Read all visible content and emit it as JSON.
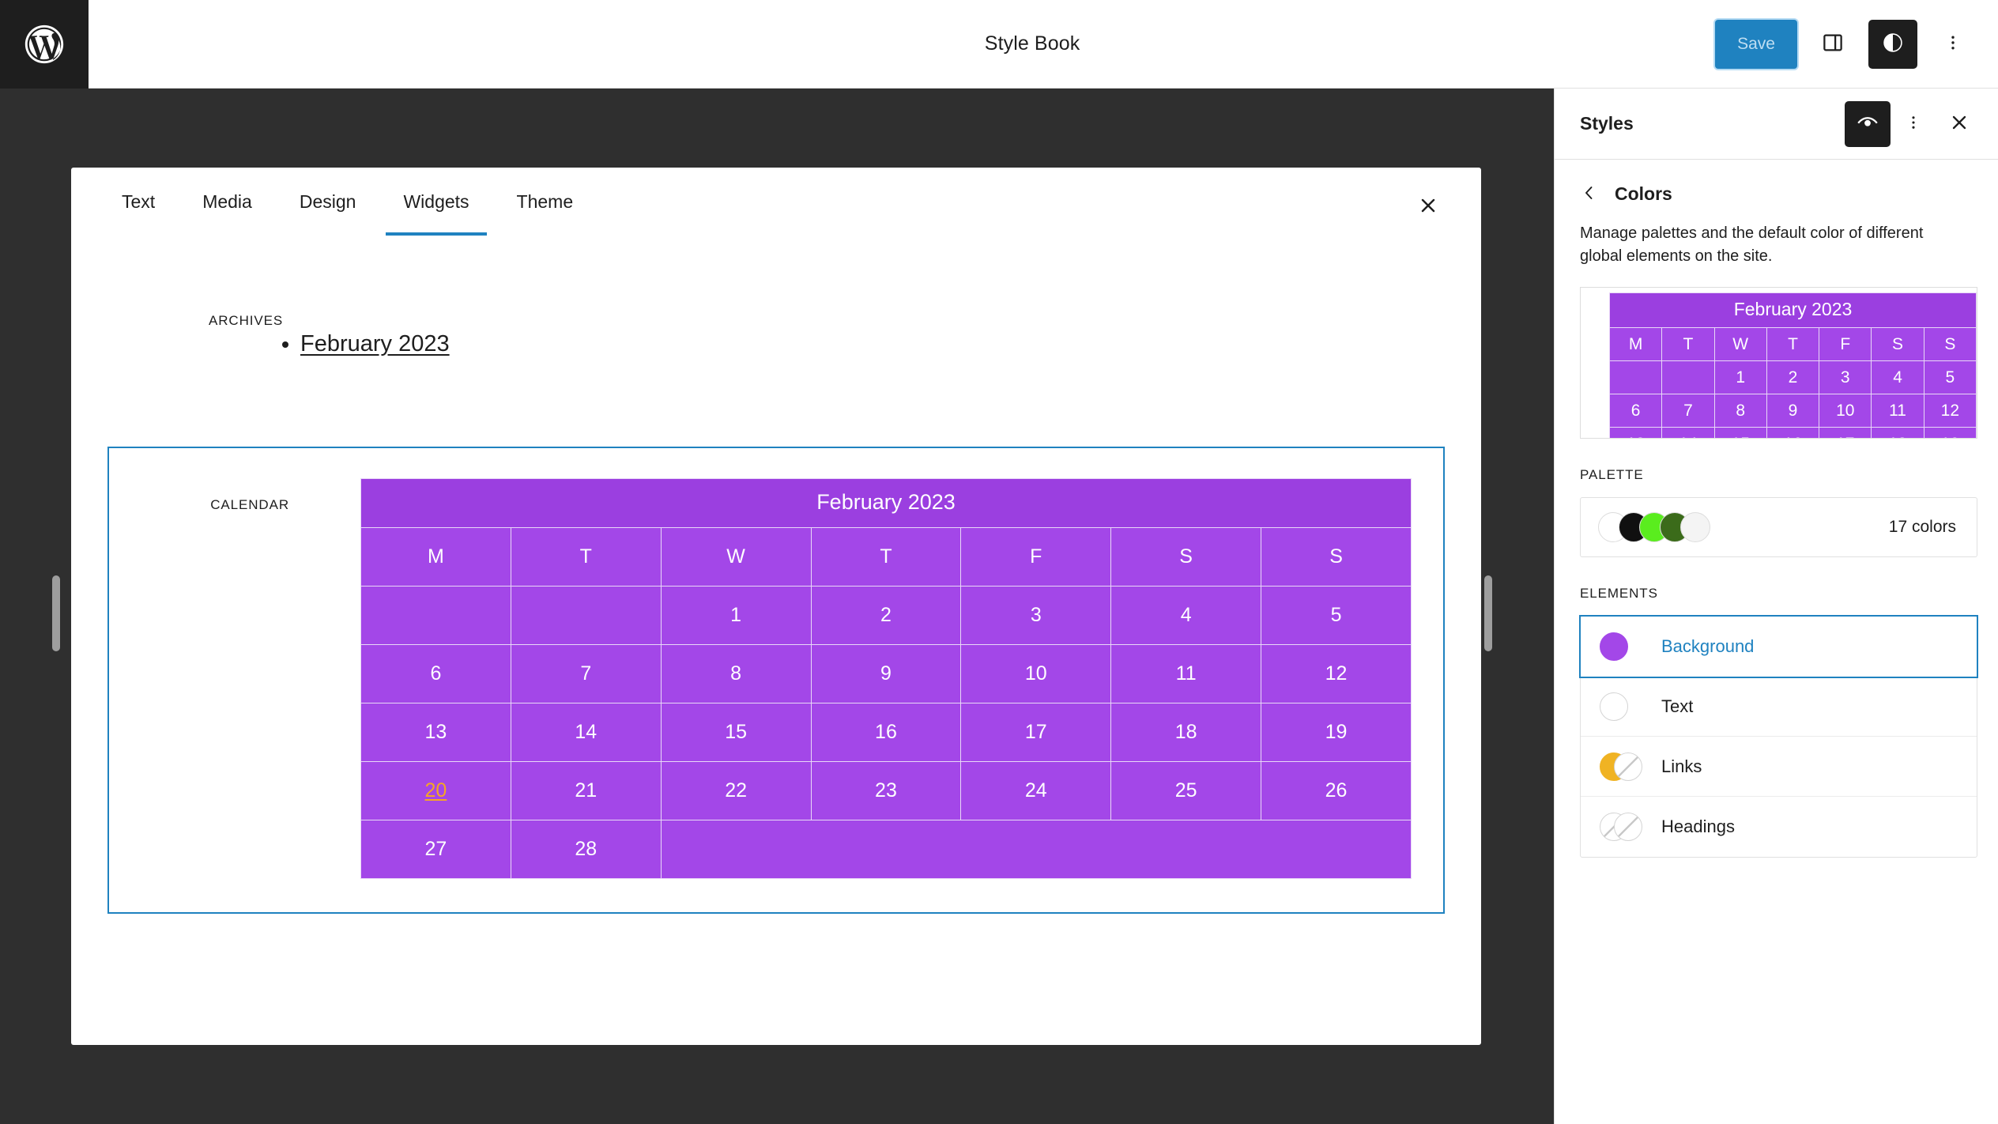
{
  "topbar": {
    "logo_icon": "wordpress-logo-icon",
    "title": "Style Book",
    "save_label": "Save",
    "sidebar_toggle_icon": "panel-layout-icon",
    "style_toggle_icon": "contrast-circle-icon",
    "more_icon": "vertical-ellipsis-icon"
  },
  "stylebook": {
    "close_icon": "close-icon",
    "tabs": [
      {
        "label": "Text",
        "active": false
      },
      {
        "label": "Media",
        "active": false
      },
      {
        "label": "Design",
        "active": false
      },
      {
        "label": "Widgets",
        "active": true
      },
      {
        "label": "Theme",
        "active": false
      }
    ],
    "archives": {
      "label": "ARCHIVES",
      "items": [
        "February 2023"
      ]
    },
    "calendar_example": {
      "label": "CALENDAR",
      "selected": true
    }
  },
  "calendar": {
    "caption": "February 2023",
    "weekdays": [
      "M",
      "T",
      "W",
      "T",
      "F",
      "S",
      "S"
    ],
    "weeks": [
      [
        "",
        "",
        "1",
        "2",
        "3",
        "4",
        "5"
      ],
      [
        "6",
        "7",
        "8",
        "9",
        "10",
        "11",
        "12"
      ],
      [
        "13",
        "14",
        "15",
        "16",
        "17",
        "18",
        "19"
      ],
      [
        "20",
        "21",
        "22",
        "23",
        "24",
        "25",
        "26"
      ],
      [
        "27",
        "28",
        "",
        "",
        "",
        "",
        ""
      ]
    ],
    "linked_day": "20",
    "colors": {
      "cell_background": "#a347e8",
      "caption_background": "#9b3fe0",
      "border": "#e9d8f7",
      "text": "#ffffff",
      "link": "#f5a623"
    }
  },
  "sidebar": {
    "title": "Styles",
    "preview_icon": "eye-icon",
    "more_icon": "vertical-ellipsis-icon",
    "close_icon": "close-icon",
    "back_icon": "chevron-left-icon",
    "section_title": "Colors",
    "description": "Manage palettes and the default color of different global elements on the site.",
    "palette": {
      "group_label": "PALETTE",
      "count_label": "17 colors",
      "swatches": [
        "#ffffff",
        "#101010",
        "#5aed1e",
        "#3b6b1a",
        "#f4f4f4"
      ]
    },
    "elements": {
      "group_label": "ELEMENTS",
      "items": [
        {
          "label": "Background",
          "selected": true,
          "swatch_style": "solid",
          "color": "#a347e8"
        },
        {
          "label": "Text",
          "selected": false,
          "swatch_style": "empty",
          "color": "#ffffff"
        },
        {
          "label": "Links",
          "selected": false,
          "swatch_style": "duo",
          "color": "#f0b323"
        },
        {
          "label": "Headings",
          "selected": false,
          "swatch_style": "striped",
          "color": "#ffffff"
        }
      ]
    }
  },
  "theme": {
    "accent": "#1f82c0",
    "canvas_background": "#2f2f2f",
    "chrome_dark": "#1e1e1e"
  }
}
